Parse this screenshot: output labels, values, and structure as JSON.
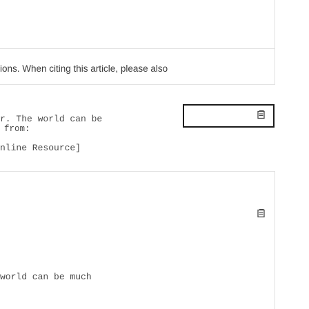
{
  "citation_notice": "ions. When citing this article, please also",
  "snippets": {
    "line1": "r. The world can be",
    "line2": "from:",
    "line3": "nline Resource]",
    "line4": "world can be much"
  },
  "icons": {
    "top": "document-icon",
    "bottom": "document-icon"
  },
  "colors": {
    "frame_border": "#1a1a1a",
    "icon": "#4a4a4a"
  }
}
